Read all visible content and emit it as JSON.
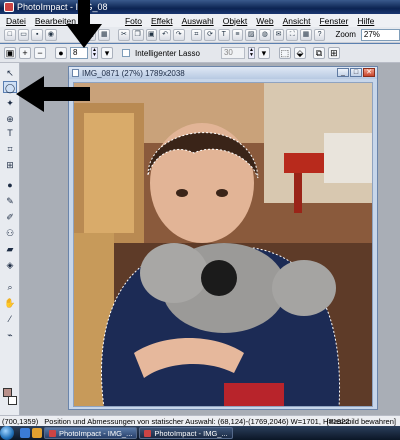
{
  "app": {
    "title": "PhotoImpact - IMG_08"
  },
  "menu": {
    "items": [
      "Datei",
      "Bearbeiten",
      "Foto",
      "Effekt",
      "Auswahl",
      "Objekt",
      "Web",
      "Ansicht",
      "Fenster",
      "Hilfe"
    ]
  },
  "toolbar": {
    "zoom_label": "Zoom",
    "zoom_value": "27%"
  },
  "options": {
    "brush_size": "8",
    "lasso_label": "Intelligenter Lasso",
    "lasso_checked": false,
    "edge_width": "30"
  },
  "document": {
    "title": "IMG_0871 (27%) 1789x2038"
  },
  "status": {
    "coords": "(700,1359)",
    "message": "Position und Abmessungen von statischer Auswahl: (68,124)-(1769,2046) W=1701, H=1922",
    "right": "[Basisbild bewahren]"
  },
  "taskbar": {
    "items": [
      "PhotoImpact - IMG_...",
      "PhotoImpact - IMG_..."
    ]
  },
  "colors": {
    "accent": "#1f4ea0",
    "foreground_swatch": "#b9908a",
    "background_swatch": "#ffffff",
    "annotation_arrow": "#000000"
  }
}
